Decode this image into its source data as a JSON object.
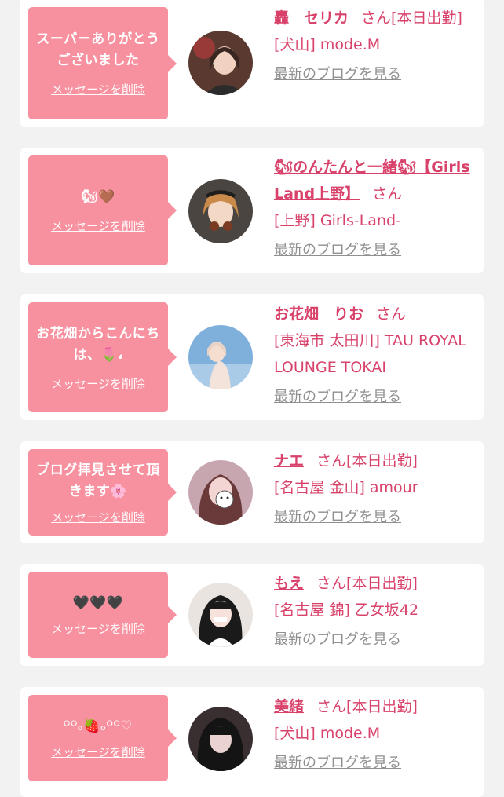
{
  "delete_label": "メッセージを削除",
  "blog_label": "最新のブログを見る",
  "san_label": "さん",
  "colors": {
    "bubble": "#f7919f",
    "accent": "#d8426a",
    "muted": "#8f8f8f",
    "background": "#f2f2f2"
  },
  "items": [
    {
      "message": "スーパーありがとうございました",
      "name": "轟　セリカ",
      "status": "[本日出勤]",
      "shop": "[犬山] mode.M"
    },
    {
      "message": "🐿🤎",
      "name": "🐿のんたんと一緒🐿【Girls Land上野】",
      "status": "",
      "shop": "[上野] Girls-Land-"
    },
    {
      "message": "お花畑からこんにちは、🌷،",
      "name": "お花畑　りお",
      "status": "",
      "shop": "[東海市 太田川] TAU ROYAL LOUNGE TOKAI"
    },
    {
      "message": "ブログ拝見させて頂きます🌸",
      "name": "ナエ",
      "status": "[本日出勤]",
      "shop": "[名古屋 金山] amour"
    },
    {
      "message": "🖤🖤🖤",
      "name": "もえ",
      "status": "[本日出勤]",
      "shop": "[名古屋 錦] 乙女坂42"
    },
    {
      "message": "ᴼᴼₒ🍓ₒᴼᴼ♡",
      "name": "美緒",
      "status": "[本日出勤]",
      "shop": "[犬山] mode.M"
    }
  ]
}
